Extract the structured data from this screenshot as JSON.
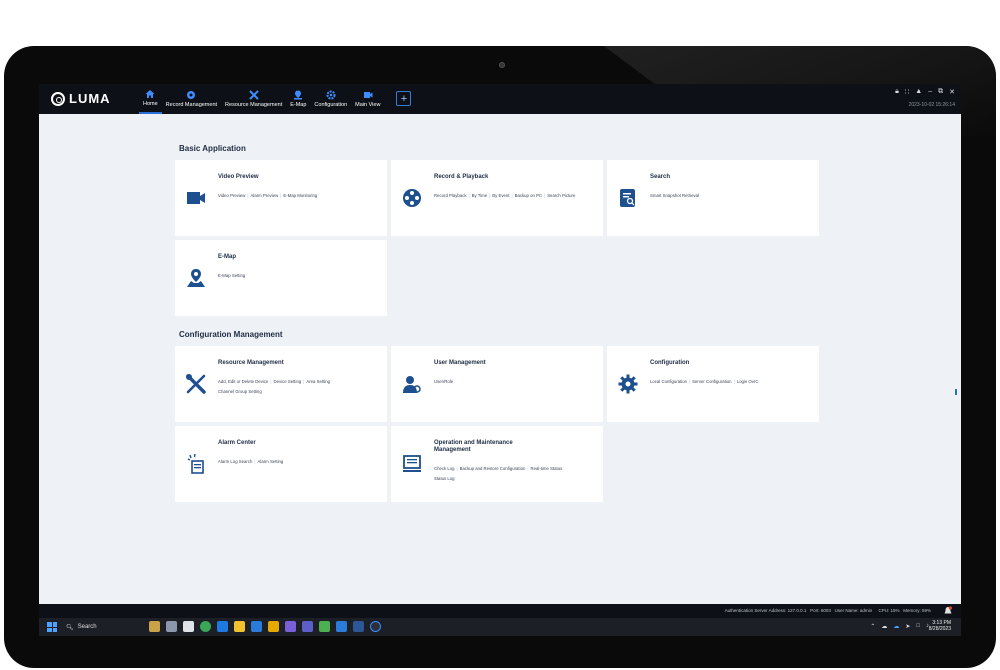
{
  "app": {
    "logo_text": "LUMA"
  },
  "nav": {
    "items": [
      {
        "label": "Home",
        "icon": "home-icon"
      },
      {
        "label": "Record Management",
        "icon": "record-icon"
      },
      {
        "label": "Resource Management",
        "icon": "tools-icon"
      },
      {
        "label": "E-Map",
        "icon": "map-pin-icon"
      },
      {
        "label": "Configuration",
        "icon": "gear-icon"
      },
      {
        "label": "Main View",
        "icon": "video-camera-icon"
      }
    ],
    "add_label": "+"
  },
  "window": {
    "datetime": "2023-10-02 15:26:14"
  },
  "sections": {
    "basic": "Basic Application",
    "config": "Configuration Management"
  },
  "cards": {
    "video_preview": {
      "title": "Video Preview",
      "links": [
        "Video Preview",
        "Alarm Preview",
        "E-Map Monitoring"
      ]
    },
    "record_playback": {
      "title": "Record & Playback",
      "links": [
        "Record Playback",
        "By Time",
        "By Event",
        "Backup on PC",
        "Search Picture"
      ]
    },
    "search": {
      "title": "Search",
      "links": [
        "Smart Snapshot Retrieval"
      ]
    },
    "emap": {
      "title": "E-Map",
      "links": [
        "E-Map Setting"
      ]
    },
    "resource": {
      "title": "Resource Management",
      "links": [
        "Add, Edit or Delete Device",
        "Device Setting",
        "Area Setting",
        "Channel Group Setting"
      ]
    },
    "user": {
      "title": "User Management",
      "links": [
        "User/Role"
      ]
    },
    "configuration": {
      "title": "Configuration",
      "links": [
        "Local Configuration",
        "Server Configuration",
        "Login OvrC"
      ]
    },
    "alarm": {
      "title": "Alarm Center",
      "links": [
        "Alarm Log Search",
        "Alarm Setting"
      ]
    },
    "ops": {
      "title": "Operation and Maintenance Management",
      "links": [
        "Check Log",
        "Backup and Restore Configuration",
        "Real-time Status",
        "Status Log"
      ]
    }
  },
  "status": {
    "auth_server": "Authentication Server Address: 127.0.0.1",
    "port": "Port: 6003",
    "user_name": "User Name: admin",
    "cpu": "CPU: 15%",
    "memory": "Memory: 59%"
  },
  "taskbar": {
    "search_label": "Search",
    "time": "3:13 PM",
    "date": "8/28/2023"
  },
  "colors": {
    "accent": "#2a6fd6",
    "icon": "#1e4f8f",
    "header_bg": "#0d1117"
  }
}
